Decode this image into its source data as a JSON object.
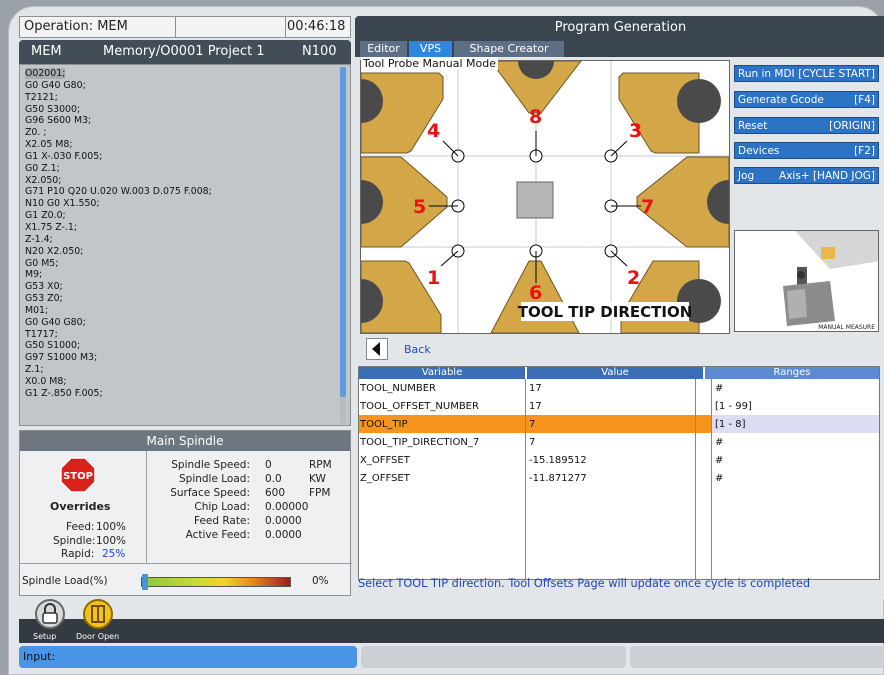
{
  "operation": {
    "label": "Operation: MEM",
    "time": "00:46:18"
  },
  "memory": {
    "mode": "MEM",
    "path": "Memory/O0001 Project 1",
    "block": "N100"
  },
  "code_lines": [
    "O02001;",
    "G0 G40 G80;",
    "T2121;",
    "G50 S3000;",
    "G96 S600 M3;",
    "Z0. ;",
    "X2.05 M8;",
    "G1 X-.030 F.005;",
    "G0 Z.1;",
    "X2.050;",
    "G71 P10 Q20 U.020 W.003 D.075 F.008;",
    "N10 G0 X1.550;",
    "G1 Z0.0;",
    "X1.75 Z-.1;",
    "Z-1.4;",
    "N20 X2.050;",
    "G0 M5;",
    "M9;",
    "G53 X0;",
    "G53 Z0;",
    "M01;",
    "G0 G40 G80;",
    "T1717;",
    "G50 S1000;",
    "G97 S1000 M3;",
    "Z.1;",
    "X0.0 M8;",
    "G1 Z-.850 F.005;"
  ],
  "spindle": {
    "title": "Main Spindle",
    "stop_label": "STOP",
    "overrides_label": "Overrides",
    "feed": {
      "label": "Feed:",
      "value": "100%"
    },
    "spindle_ovr": {
      "label": "Spindle:",
      "value": "100%"
    },
    "rapid": {
      "label": "Rapid:",
      "value": "25%"
    },
    "rows": [
      {
        "label": "Spindle Speed:",
        "value": "0",
        "unit": "RPM"
      },
      {
        "label": "Spindle Load:",
        "value": "0.0",
        "unit": "KW"
      },
      {
        "label": "Surface Speed:",
        "value": "600",
        "unit": "FPM"
      },
      {
        "label": "Chip Load:",
        "value": "0.00000",
        "unit": ""
      },
      {
        "label": "Feed Rate:",
        "value": "0.0000",
        "unit": ""
      },
      {
        "label": "Active Feed:",
        "value": "0.0000",
        "unit": ""
      }
    ],
    "load_label": "Spindle Load(%)",
    "load_value": "0%",
    "load_fraction": 0.0
  },
  "program": {
    "title": "Program Generation",
    "tabs": [
      "Editor",
      "VPS",
      "Shape Creator"
    ],
    "probe_title": "Tool Probe Manual Mode",
    "diagram_caption": "TOOL TIP DIRECTION",
    "tip_numbers": [
      "1",
      "2",
      "3",
      "4",
      "5",
      "6",
      "7",
      "8"
    ],
    "buttons": [
      {
        "left": "Run in MDI",
        "right": "[CYCLE START]"
      },
      {
        "left": "Generate Gcode",
        "right": "[F4]"
      },
      {
        "left": "Reset",
        "right": "[ORIGIN]"
      },
      {
        "left": "Devices",
        "right": "[F2]"
      },
      {
        "left": "Jog",
        "right": "Axis+ [HAND JOG]"
      }
    ],
    "thumb_caption": "MANUAL MEASURE",
    "back_label": "Back",
    "table": {
      "headers": [
        "Variable",
        "Value",
        "Ranges"
      ],
      "rows": [
        {
          "variable": "TOOL_NUMBER",
          "value": "17",
          "range": "#"
        },
        {
          "variable": "TOOL_OFFSET_NUMBER",
          "value": "17",
          "range": "[1 - 99]"
        },
        {
          "variable": "TOOL_TIP",
          "value": "7",
          "range": "[1 - 8]"
        },
        {
          "variable": "TOOL_TIP_DIRECTION_7",
          "value": "7",
          "range": "#"
        },
        {
          "variable": "X_OFFSET",
          "value": "-15.189512",
          "range": "#"
        },
        {
          "variable": "Z_OFFSET",
          "value": "-11.871277",
          "range": "#"
        }
      ]
    },
    "status": "Select TOOL TIP direction. Tool Offsets Page will update once cycle is completed"
  },
  "bottom": {
    "setup_label": "Setup",
    "door_label": "Door Open",
    "input_label": "Input:"
  },
  "colors": {
    "accent": "#2e86e0",
    "selected_row": "#f7941d",
    "insert": "#d3a648",
    "stop_red": "#d9221c"
  }
}
